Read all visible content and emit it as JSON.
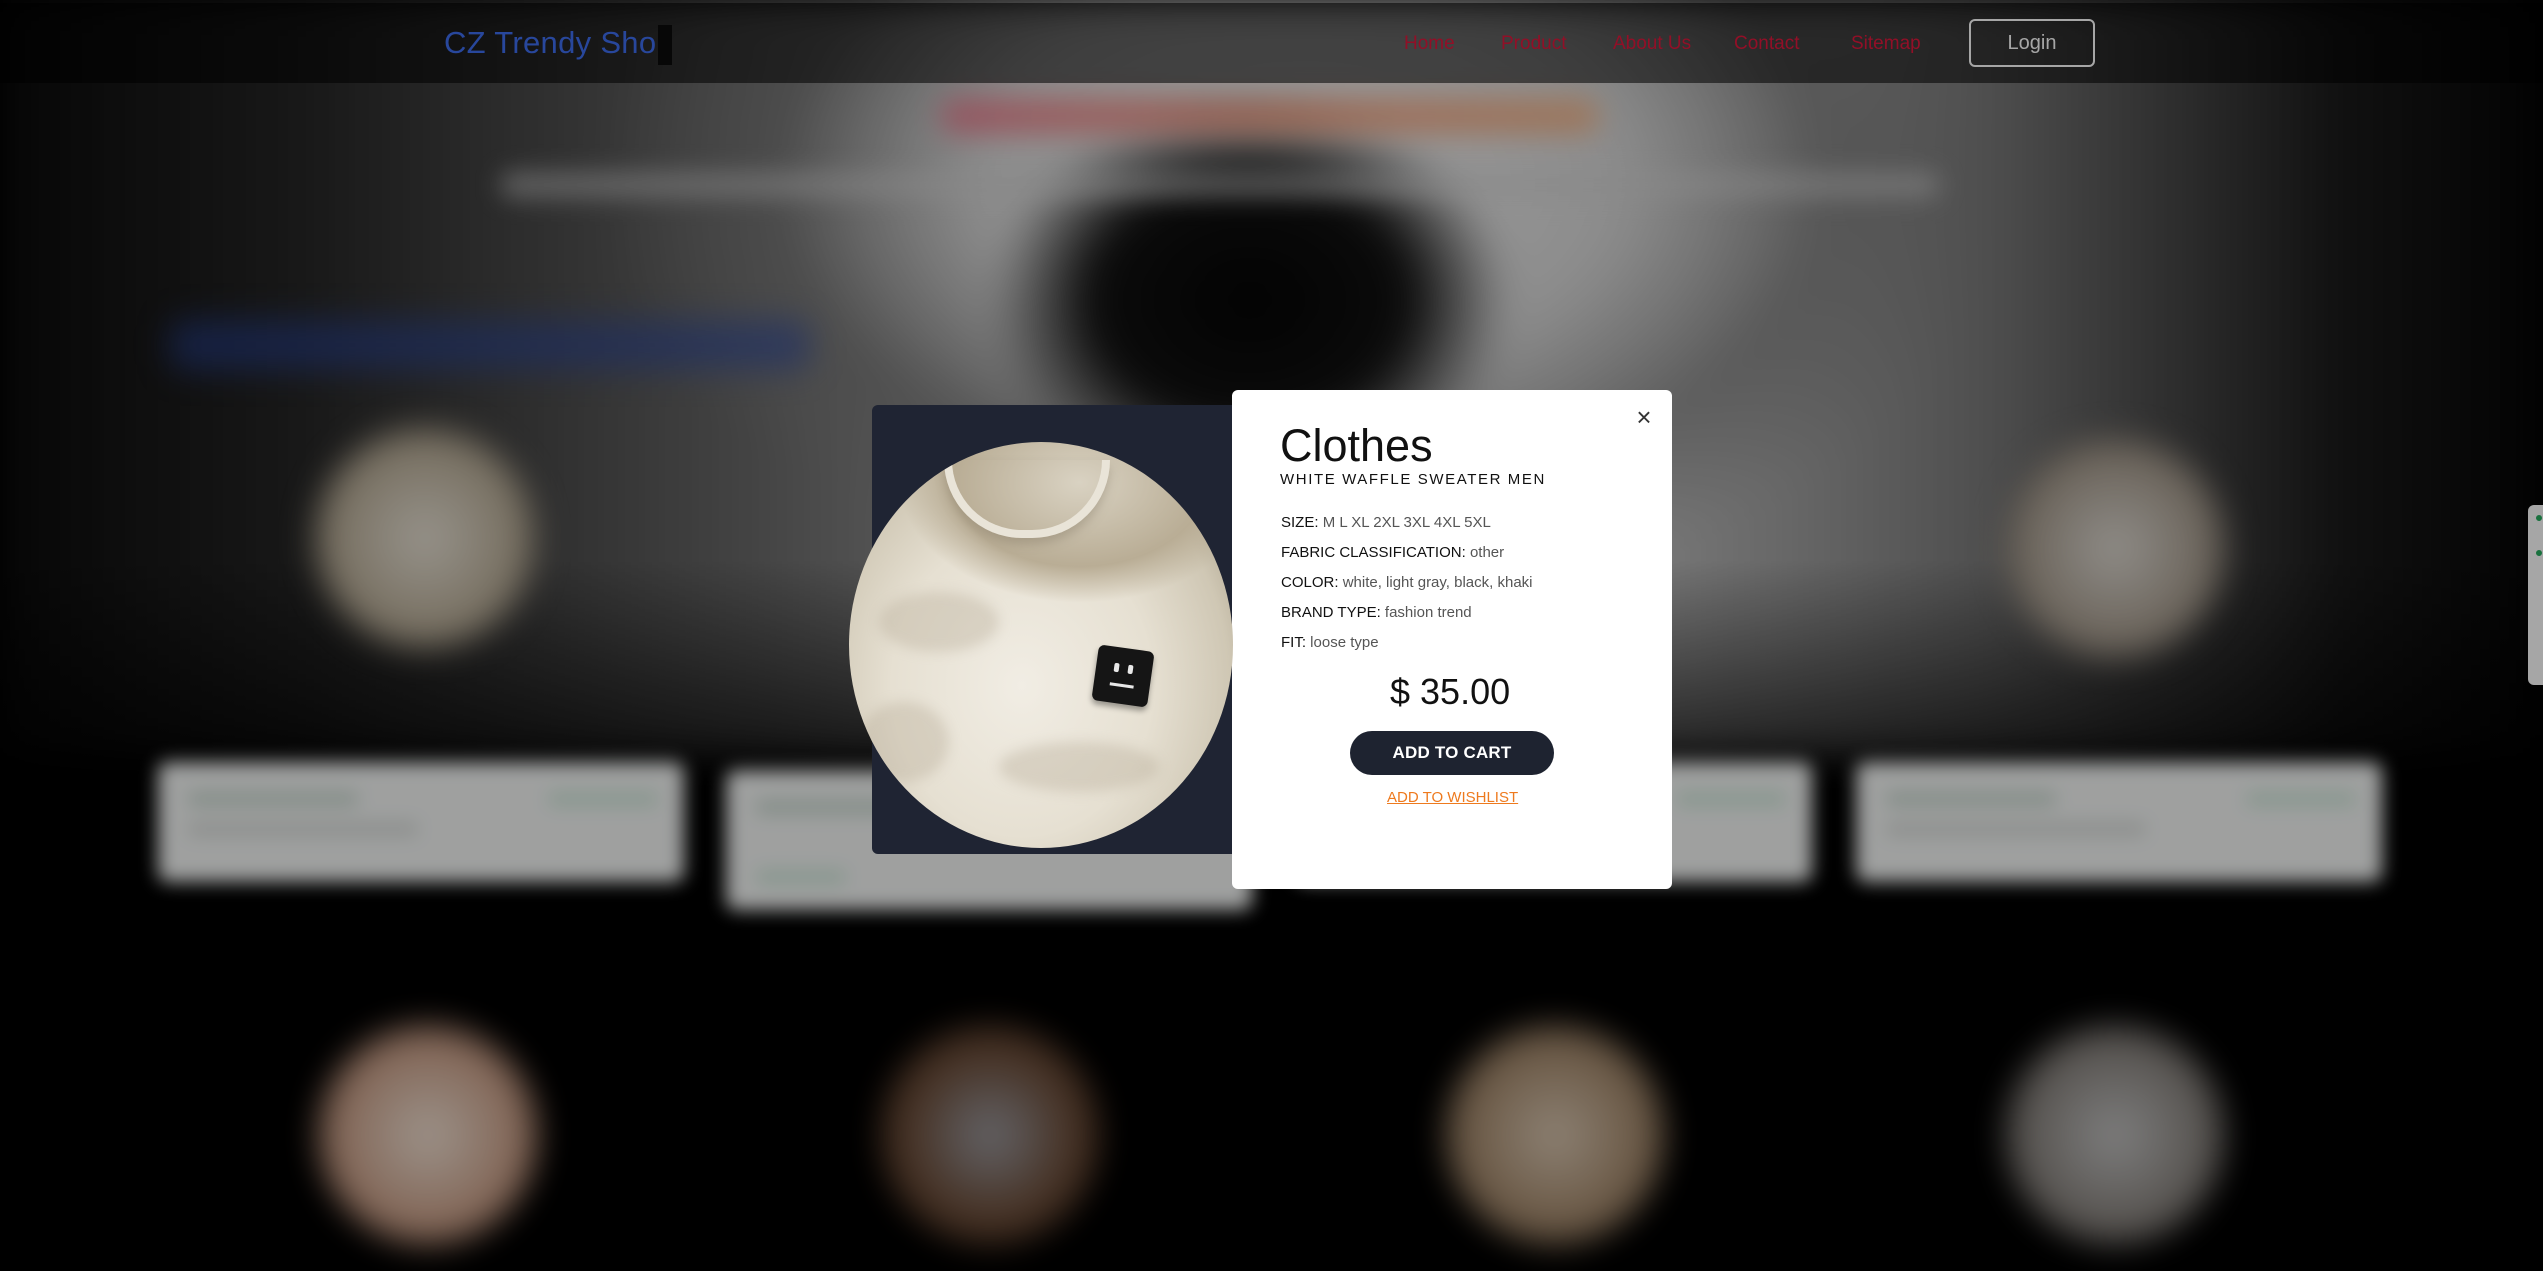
{
  "header": {
    "brand": "CZ Trendy Sho",
    "nav": [
      "Home",
      "Product",
      "About Us",
      "Contact",
      "Sitemap"
    ],
    "login_label": "Login"
  },
  "modal": {
    "close_glyph": "×",
    "category": "Clothes",
    "product_name": "WHITE WAFFLE SWEATER MEN",
    "specs": [
      {
        "label": "SIZE:",
        "value": "M L XL 2XL 3XL 4XL 5XL"
      },
      {
        "label": "FABRIC CLASSIFICATION:",
        "value": "other"
      },
      {
        "label": "COLOR:",
        "value": "white, light gray, black, khaki"
      },
      {
        "label": "BRAND TYPE:",
        "value": "fashion trend"
      },
      {
        "label": "FIT:",
        "value": "loose type"
      }
    ],
    "price": "$ 35.00",
    "add_to_cart": "ADD TO CART",
    "add_to_wishlist": "ADD TO WISHLIST"
  },
  "colors": {
    "brand": "#3e6df0",
    "nav_link": "#e0183c",
    "cart_button": "#1e2330",
    "wishlist_link": "#ee7a1e",
    "image_panel": "#1f2433"
  },
  "icons": {
    "close": "close-icon"
  }
}
